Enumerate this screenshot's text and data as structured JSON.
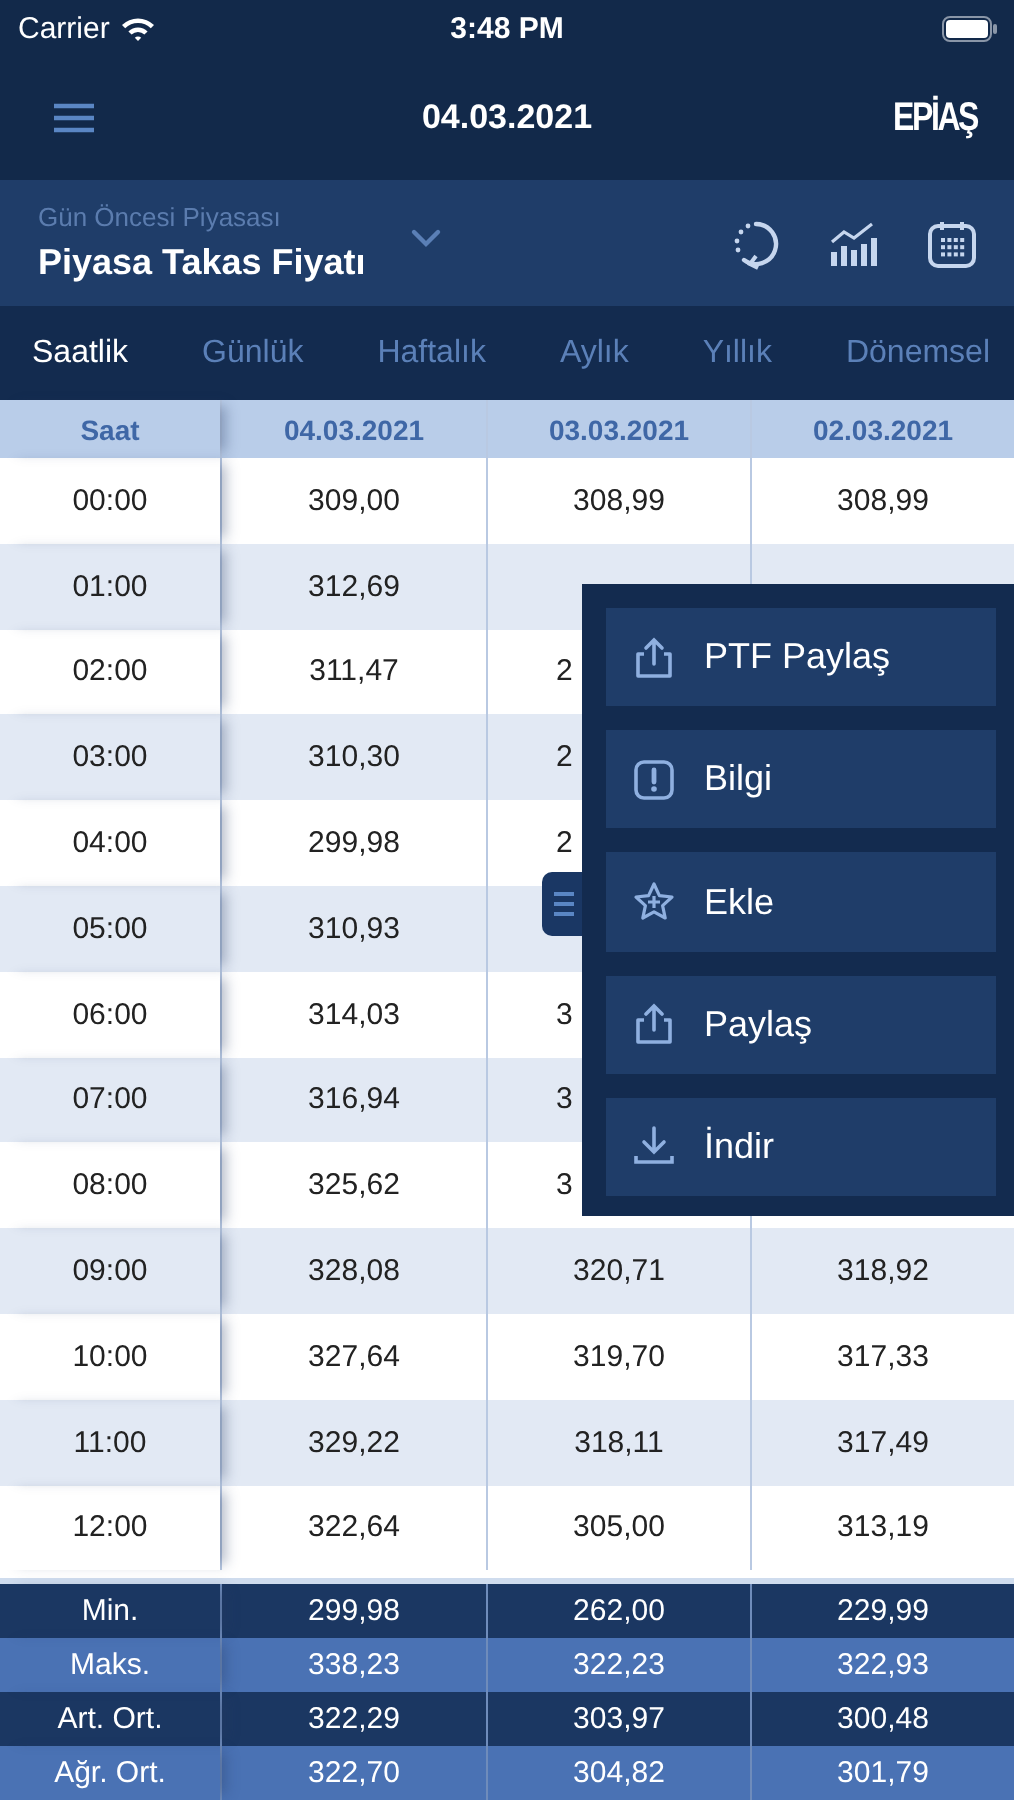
{
  "status_bar": {
    "carrier": "Carrier",
    "time": "3:48 PM"
  },
  "nav": {
    "title": "04.03.2021",
    "logo": "EPİAŞ"
  },
  "selector": {
    "category": "Gün Öncesi Piyasası",
    "title": "Piyasa Takas Fiyatı"
  },
  "tabs": [
    {
      "label": "Saatlik",
      "selected": true
    },
    {
      "label": "Günlük",
      "selected": false
    },
    {
      "label": "Haftalık",
      "selected": false
    },
    {
      "label": "Aylık",
      "selected": false
    },
    {
      "label": "Yıllık",
      "selected": false
    },
    {
      "label": "Dönemsel",
      "selected": false
    }
  ],
  "table": {
    "columns": [
      "Saat",
      "04.03.2021",
      "03.03.2021",
      "02.03.2021"
    ],
    "rows": [
      {
        "time": "00:00",
        "values": [
          "309,00",
          "308,99",
          "308,99"
        ]
      },
      {
        "time": "01:00",
        "values": [
          "312,69"
        ]
      },
      {
        "time": "02:00",
        "values": [
          "311,47"
        ],
        "partial": "2"
      },
      {
        "time": "03:00",
        "values": [
          "310,30"
        ],
        "partial": "2"
      },
      {
        "time": "04:00",
        "values": [
          "299,98"
        ],
        "partial": "2"
      },
      {
        "time": "05:00",
        "values": [
          "310,93"
        ]
      },
      {
        "time": "06:00",
        "values": [
          "314,03"
        ],
        "partial": "3"
      },
      {
        "time": "07:00",
        "values": [
          "316,94"
        ],
        "partial": "3"
      },
      {
        "time": "08:00",
        "values": [
          "325,62"
        ],
        "partial": "3"
      },
      {
        "time": "09:00",
        "values": [
          "328,08",
          "320,71",
          "318,92"
        ]
      },
      {
        "time": "10:00",
        "values": [
          "327,64",
          "319,70",
          "317,33"
        ]
      },
      {
        "time": "11:00",
        "values": [
          "329,22",
          "318,11",
          "317,49"
        ]
      },
      {
        "time": "12:00",
        "values": [
          "322,64",
          "305,00",
          "313,19"
        ]
      }
    ],
    "summary": [
      {
        "label": "Min.",
        "values": [
          "299,98",
          "262,00",
          "229,99"
        ]
      },
      {
        "label": "Maks.",
        "values": [
          "338,23",
          "322,23",
          "322,93"
        ]
      },
      {
        "label": "Art. Ort.",
        "values": [
          "322,29",
          "303,97",
          "300,48"
        ]
      },
      {
        "label": "Ağr. Ort.",
        "values": [
          "322,70",
          "304,82",
          "301,79"
        ]
      }
    ]
  },
  "menu": {
    "items": [
      {
        "kind": "share",
        "label": "PTF Paylaş"
      },
      {
        "kind": "info",
        "label": "Bilgi"
      },
      {
        "kind": "favorite",
        "label": "Ekle"
      },
      {
        "kind": "share",
        "label": "Paylaş"
      },
      {
        "kind": "download",
        "label": "İndir"
      }
    ]
  }
}
